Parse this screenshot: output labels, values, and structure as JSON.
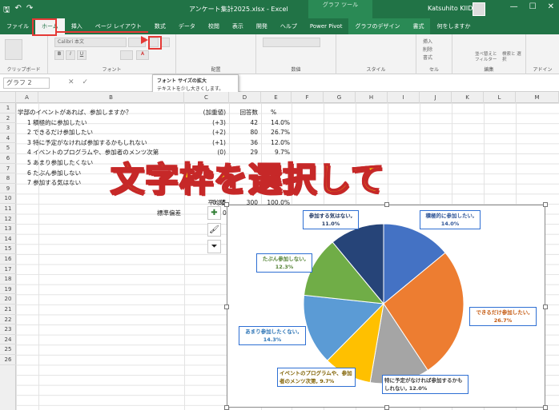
{
  "window": {
    "file_name": "アンケート集計2025.xlsx - Excel",
    "context_tab_header": "グラフ ツール",
    "user": "Katsuhito KIIDA"
  },
  "tabs": [
    "ファイル",
    "ホーム",
    "挿入",
    "ページ レイアウト",
    "数式",
    "データ",
    "校閲",
    "表示",
    "開発",
    "ヘルプ",
    "Power Pivot",
    "グラフのデザイン",
    "書式",
    "何をしますか"
  ],
  "ribbon": {
    "font_name": "Calibri 本文",
    "groups": [
      "クリップボード",
      "フォント",
      "配置",
      "数値",
      "スタイル",
      "セル",
      "編集",
      "アドイン"
    ],
    "cells_insert": "挿入",
    "cells_delete": "削除",
    "cells_format": "書式",
    "sort_filter": "並べ替えと フィルター",
    "find_select": "検索と 選択"
  },
  "tooltip": {
    "title": "フォント サイズの拡大",
    "body": "テキストを少し大きくします。"
  },
  "formula_bar": {
    "name_box": "グラフ 2"
  },
  "columns": [
    "A",
    "B",
    "C",
    "D",
    "E",
    "F",
    "G",
    "H",
    "I",
    "J",
    "K",
    "L",
    "M"
  ],
  "rows": [
    "1",
    "2",
    "3",
    "4",
    "5",
    "6",
    "7",
    "8",
    "9",
    "10",
    "11",
    "12",
    "13",
    "14",
    "15",
    "16",
    "17",
    "18",
    "19",
    "20",
    "21",
    "22",
    "23",
    "24",
    "25",
    "26"
  ],
  "sheet": {
    "question": "学部のイベントがあれば、参加しますか？",
    "h_weight": "(加重値)",
    "h_count": "回答数",
    "h_pct": "%",
    "items": [
      {
        "label": "1 積極的に参加したい",
        "w": "(+3)",
        "n": "42",
        "p": "14.0%"
      },
      {
        "label": "2 できるだけ参加したい",
        "w": "(+2)",
        "n": "80",
        "p": "26.7%"
      },
      {
        "label": "3 特に予定がなければ参加するかもしれない",
        "w": "(+1)",
        "n": "36",
        "p": "12.0%"
      },
      {
        "label": "4 イベントのプログラムや、参加者のメンツ次第",
        "w": "(0)",
        "n": "29",
        "p": "9.7%"
      },
      {
        "label": "5 あまり参加したくない",
        "w": "",
        "n": "",
        "p": ""
      },
      {
        "label": "6 たぶん参加しない",
        "w": "",
        "n": "",
        "p": ""
      },
      {
        "label": "7 参加する気はない",
        "w": "",
        "n": "",
        "p": ""
      }
    ],
    "avg_label": "平均値",
    "avg_value": "0.35",
    "total_n": "300",
    "total_p": "100.0%",
    "sd_label": "標準偏差",
    "sd_value": "0"
  },
  "overlay_text": "文字枠を選択して",
  "chart_data": {
    "type": "pie",
    "slices": [
      {
        "label": "積極的に参加したい,",
        "value": 14.0,
        "value_label": "14.0%",
        "color": "#4472c4"
      },
      {
        "label": "できるだけ参加したい,",
        "value": 26.7,
        "value_label": "26.7%",
        "color": "#ed7d31"
      },
      {
        "label": "特に予定がなければ参加するかもしれない,",
        "value": 12.0,
        "value_label": "12.0%",
        "color": "#a5a5a5"
      },
      {
        "label": "イベントのプログラムや、参加者のメンツ次第,",
        "value": 9.7,
        "value_label": "9.7%",
        "color": "#ffc000"
      },
      {
        "label": "あまり参加したくない,",
        "value": 14.3,
        "value_label": "14.3%",
        "color": "#5b9bd5"
      },
      {
        "label": "たぶん参加しない,",
        "value": 12.3,
        "value_label": "12.3%",
        "color": "#70ad47"
      },
      {
        "label": "参加する気はない,",
        "value": 11.0,
        "value_label": "11.0%",
        "color": "#264478"
      }
    ]
  }
}
